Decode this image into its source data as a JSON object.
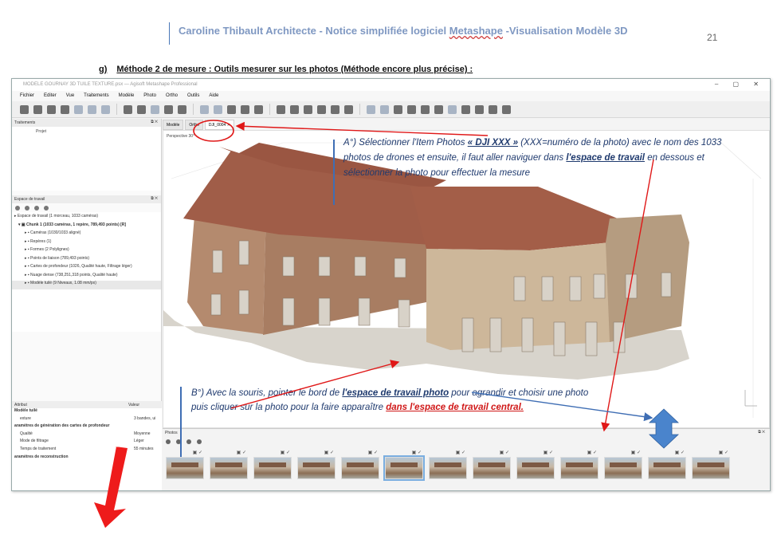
{
  "header": {
    "title_prefix": "Caroline Thibault Architecte - Notice simplifiée logiciel ",
    "title_software": "Metashape",
    "title_suffix": " -Visualisation Modèle 3D",
    "page_number": "21"
  },
  "section": {
    "number": "g)",
    "title": "Méthode 2 de mesure : Outils mesurer sur les photos (Méthode encore plus précise) :"
  },
  "app": {
    "window_title": "MODELE GOURNAY 3D TUILE TEXTURE.psx — Agisoft Metashape Professional",
    "menu": [
      "Fichier",
      "Editer",
      "Vue",
      "Traitements",
      "Modèle",
      "Photo",
      "Ortho",
      "Outils",
      "Aide"
    ],
    "panels": {
      "traitements": {
        "title": "Traitements",
        "column": "Projet"
      },
      "workspace": {
        "title": "Espace de travail",
        "items": [
          "Espace de travail (1 morceau, 1033 caméras)",
          "Chunk 1 (1033 caméras, 1 repère, 789,493 points) [R]",
          "Caméras (1030/1033 aligné)",
          "Repères (1)",
          "Formes (2 Polylignes)",
          "Points de liaison (789,493 points)",
          "Cartes de profondeur (1026, Qualité haute, Filtrage léger)",
          "Nuage dense (738,251,318 points, Qualité haute)",
          "Modèle tuilé (9 Niveaux, 1.08 mm/px)"
        ]
      },
      "properties": {
        "col_attr": "Attribut",
        "col_val": "Valeur",
        "rows": [
          {
            "attr": "Modèle tuilé",
            "val": "",
            "bold": true
          },
          {
            "attr": "exture",
            "val": "3 bandes, ui",
            "bold": false
          },
          {
            "attr": "aramètres de génération des cartes de profondeur",
            "val": "",
            "bold": true
          },
          {
            "attr": "Qualité",
            "val": "Moyenne",
            "bold": false
          },
          {
            "attr": "Mode de filtrage",
            "val": "Léger",
            "bold": false
          },
          {
            "attr": "Temps de traitement",
            "val": "55 minutes",
            "bold": false
          },
          {
            "attr": "aramètres de reconstruction",
            "val": "",
            "bold": true
          }
        ]
      }
    },
    "tabs": [
      "Modèle",
      "Ortho",
      "DJI_0004"
    ],
    "viewport_label": "Perspective 30°",
    "photos_panel_title": "Photos",
    "thumb_check": "▣ ✓",
    "thumbs_count": 13,
    "selected_thumb": 5
  },
  "annotations": {
    "a": {
      "t1": "A°) Sélectionner l'Item Photos ",
      "k1": "« DJI XXX »",
      "t2": " (XXX=numéro de la photo) avec le nom des 1033 photos de drones et ensuite, il faut aller naviguer dans ",
      "k2": "l'espace de travail",
      "t3": " en dessous et sélectionner la photo pour effectuer la mesure"
    },
    "b": {
      "t1": "B°) Avec la souris, pointer le bord de ",
      "k1": "l'espace de travail photo",
      "t2": " pour agrandir et choisir une photo puis cliquer sur la photo pour la faire apparaître ",
      "k2": "dans l'espace de travail central."
    }
  },
  "colors": {
    "annotation_text": "#1f3a6e",
    "arrow_red": "#e01818",
    "arrow_blue": "#3f6eb4",
    "resize_icon": "#4a84cc"
  }
}
